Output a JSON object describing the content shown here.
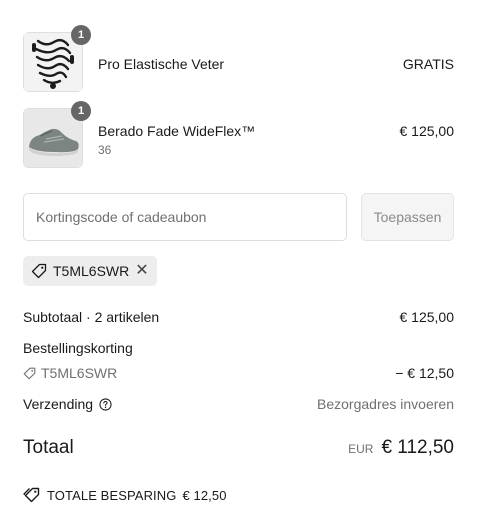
{
  "items": [
    {
      "name": "Pro Elastische Veter",
      "variant": "",
      "price": "GRATIS",
      "quantity": "1",
      "image_icon": "elastic-laces-image"
    },
    {
      "name": "Berado Fade WideFlex™",
      "variant": "36",
      "price": "€ 125,00",
      "quantity": "1",
      "image_icon": "sneaker-image"
    }
  ],
  "discount": {
    "placeholder": "Kortingscode of cadeaubon",
    "value": "",
    "apply_label": "Toepassen",
    "applied_code": "T5ML6SWR",
    "remove_icon": "close-icon",
    "tag_icon": "tag-icon"
  },
  "summary": {
    "subtotal_label": "Subtotaal · 2 artikelen",
    "subtotal_value": "€ 125,00",
    "order_discount_label": "Bestellingskorting",
    "order_discount_code": "T5ML6SWR",
    "order_discount_value": "− € 12,50",
    "shipping_label": "Verzending",
    "shipping_help_icon": "help-icon",
    "shipping_value": "Bezorgadres invoeren",
    "total_label": "Totaal",
    "total_currency": "EUR",
    "total_value": "€ 112,50",
    "savings_label": "TOTALE BESPARING",
    "savings_value": "€ 12,50"
  },
  "colors": {
    "badge": "#666666",
    "border": "#dedede",
    "muted_text": "#707070",
    "tag_background": "#ededed"
  }
}
